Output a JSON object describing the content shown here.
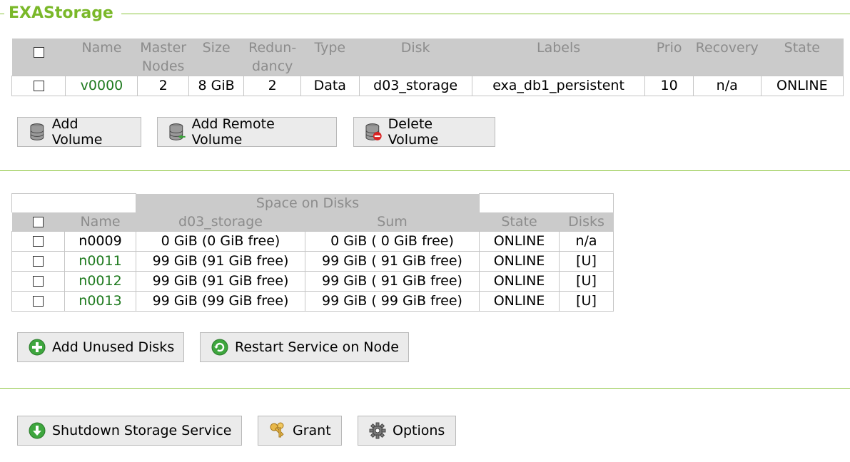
{
  "section_title": "EXAStorage",
  "volumes": {
    "headers": {
      "name": "Name",
      "master_nodes_1": "Master",
      "master_nodes_2": "Nodes",
      "size": "Size",
      "redundancy_1": "Redun-",
      "redundancy_2": "dancy",
      "type": "Type",
      "disk": "Disk",
      "labels": "Labels",
      "prio": "Prio",
      "recovery": "Recovery",
      "state": "State"
    },
    "rows": [
      {
        "name": "v0000",
        "master_nodes": "2",
        "size": "8 GiB",
        "redundancy": "2",
        "type": "Data",
        "disk": "d03_storage",
        "labels": "exa_db1_persistent",
        "prio": "10",
        "recovery": "n/a",
        "state": "ONLINE"
      }
    ],
    "buttons": {
      "add_volume": "Add Volume",
      "add_remote_volume": "Add Remote Volume",
      "delete_volume": "Delete Volume"
    }
  },
  "nodes": {
    "space_caption": "Space on Disks",
    "headers": {
      "name": "Name",
      "d03_storage": "d03_storage",
      "sum": "Sum",
      "state": "State",
      "disks": "Disks"
    },
    "rows": [
      {
        "name": "n0009",
        "d03": "0 GiB (0 GiB free)",
        "sum": "0 GiB ( 0 GiB free)",
        "state": "ONLINE",
        "disks": "n/a"
      },
      {
        "name": "n0011",
        "d03": "99 GiB (91 GiB free)",
        "sum": "99 GiB ( 91 GiB free)",
        "state": "ONLINE",
        "disks": "[U]"
      },
      {
        "name": "n0012",
        "d03": "99 GiB (91 GiB free)",
        "sum": "99 GiB ( 91 GiB free)",
        "state": "ONLINE",
        "disks": "[U]"
      },
      {
        "name": "n0013",
        "d03": "99 GiB (99 GiB free)",
        "sum": "99 GiB ( 99 GiB free)",
        "state": "ONLINE",
        "disks": "[U]"
      }
    ],
    "buttons": {
      "add_unused_disks": "Add Unused Disks",
      "restart_service": "Restart Service on Node"
    }
  },
  "footer_buttons": {
    "shutdown": "Shutdown Storage Service",
    "grant": "Grant",
    "options": "Options"
  },
  "colors": {
    "accent_green": "#7ab829",
    "link_green": "#1f7a1f",
    "header_gray": "#cbcbcb"
  }
}
